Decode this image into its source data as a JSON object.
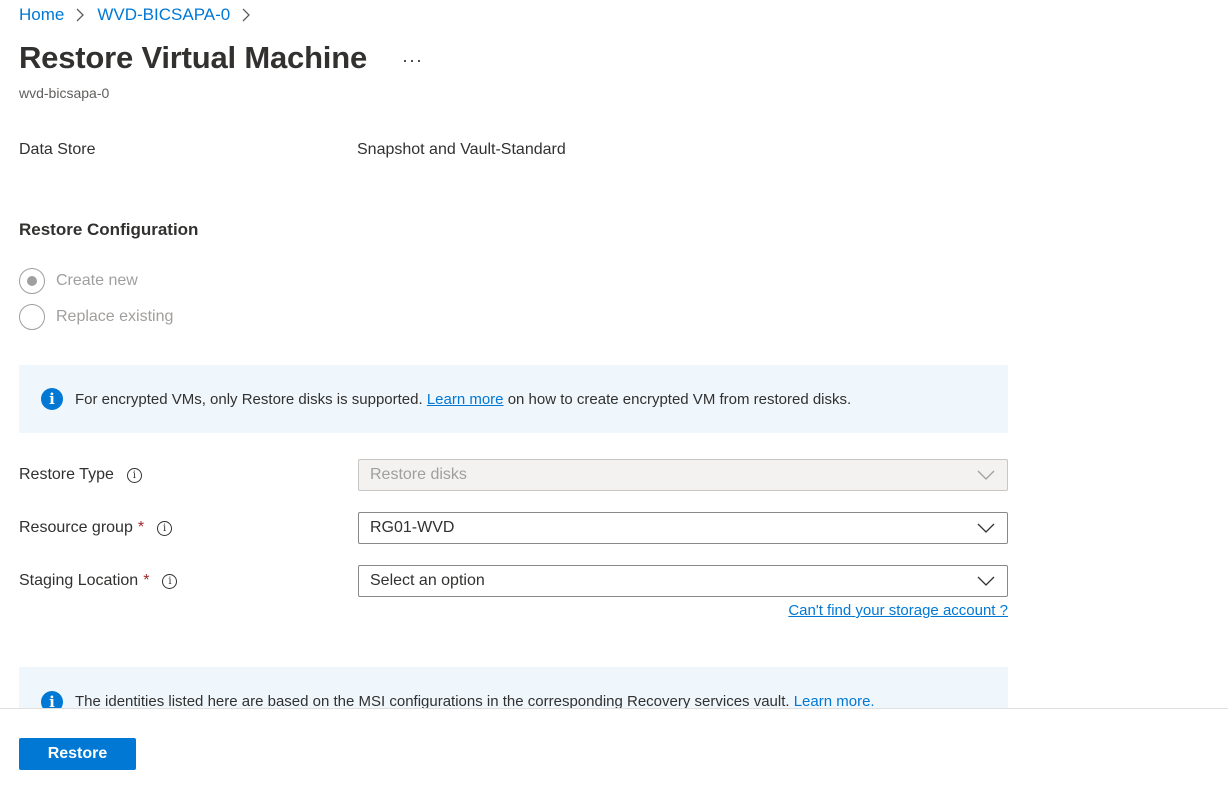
{
  "breadcrumb": {
    "home": "Home",
    "parent": "WVD-BICSAPA-0"
  },
  "header": {
    "title": "Restore Virtual Machine",
    "more": "···",
    "subtitle": "wvd-bicsapa-0"
  },
  "data_store": {
    "label": "Data Store",
    "value": "Snapshot and Vault-Standard"
  },
  "restore_config": {
    "title": "Restore Configuration",
    "options": [
      {
        "label": "Create new",
        "checked": true
      },
      {
        "label": "Replace existing",
        "checked": false
      }
    ]
  },
  "info1": {
    "text_before": "For encrypted VMs, only Restore disks is supported. ",
    "link": "Learn more",
    "text_after": " on how to create encrypted VM from restored disks."
  },
  "fields": {
    "restore_type": {
      "label": "Restore Type",
      "value": "Restore disks"
    },
    "resource_group": {
      "label": "Resource group",
      "required": "*",
      "value": "RG01-WVD"
    },
    "staging_location": {
      "label": "Staging Location",
      "required": "*",
      "value": "Select an option"
    }
  },
  "storage_link": "Can't find your storage account ?",
  "info2": {
    "text": "The identities listed here are based on the MSI configurations in the corresponding Recovery services vault. ",
    "link": "Learn more."
  },
  "footer": {
    "restore_label": "Restore"
  },
  "colors": {
    "accent": "#0078d4",
    "info_bg": "#eff6fc",
    "required": "#a4262c"
  }
}
